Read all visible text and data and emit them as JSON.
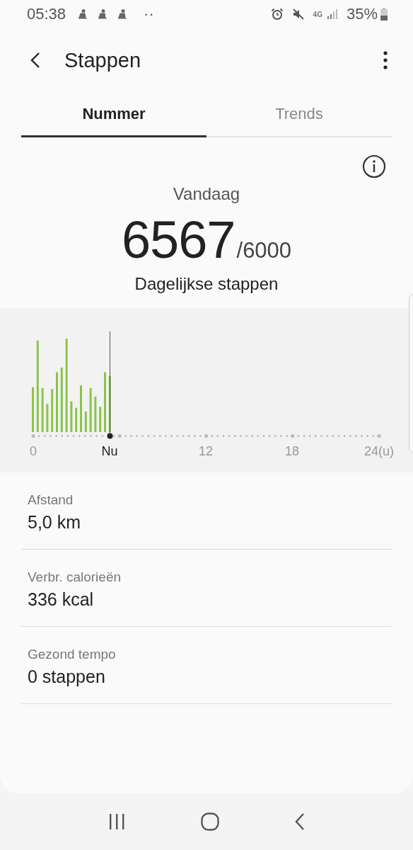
{
  "status_bar": {
    "time": "05:38",
    "dots": "··",
    "network": "4G",
    "battery": "35%"
  },
  "header": {
    "title": "Stappen"
  },
  "tabs": [
    {
      "label": "Nummer",
      "selected": true
    },
    {
      "label": "Trends",
      "selected": false
    }
  ],
  "summary": {
    "period": "Vandaag",
    "steps": "6567",
    "goal": "/6000",
    "caption": "Dagelijkse stappen"
  },
  "chart": {
    "axis_labels": [
      {
        "label": "0",
        "current": false
      },
      {
        "label": "Nu",
        "current": true
      },
      {
        "label": "12",
        "current": false
      },
      {
        "label": "18",
        "current": false
      },
      {
        "label": "24(u)",
        "current": false
      }
    ]
  },
  "stats": [
    {
      "label": "Afstand",
      "value": "5,0 km"
    },
    {
      "label": "Verbr. calorieën",
      "value": "336 kcal"
    },
    {
      "label": "Gezond tempo",
      "value": "0 stappen"
    }
  ]
}
